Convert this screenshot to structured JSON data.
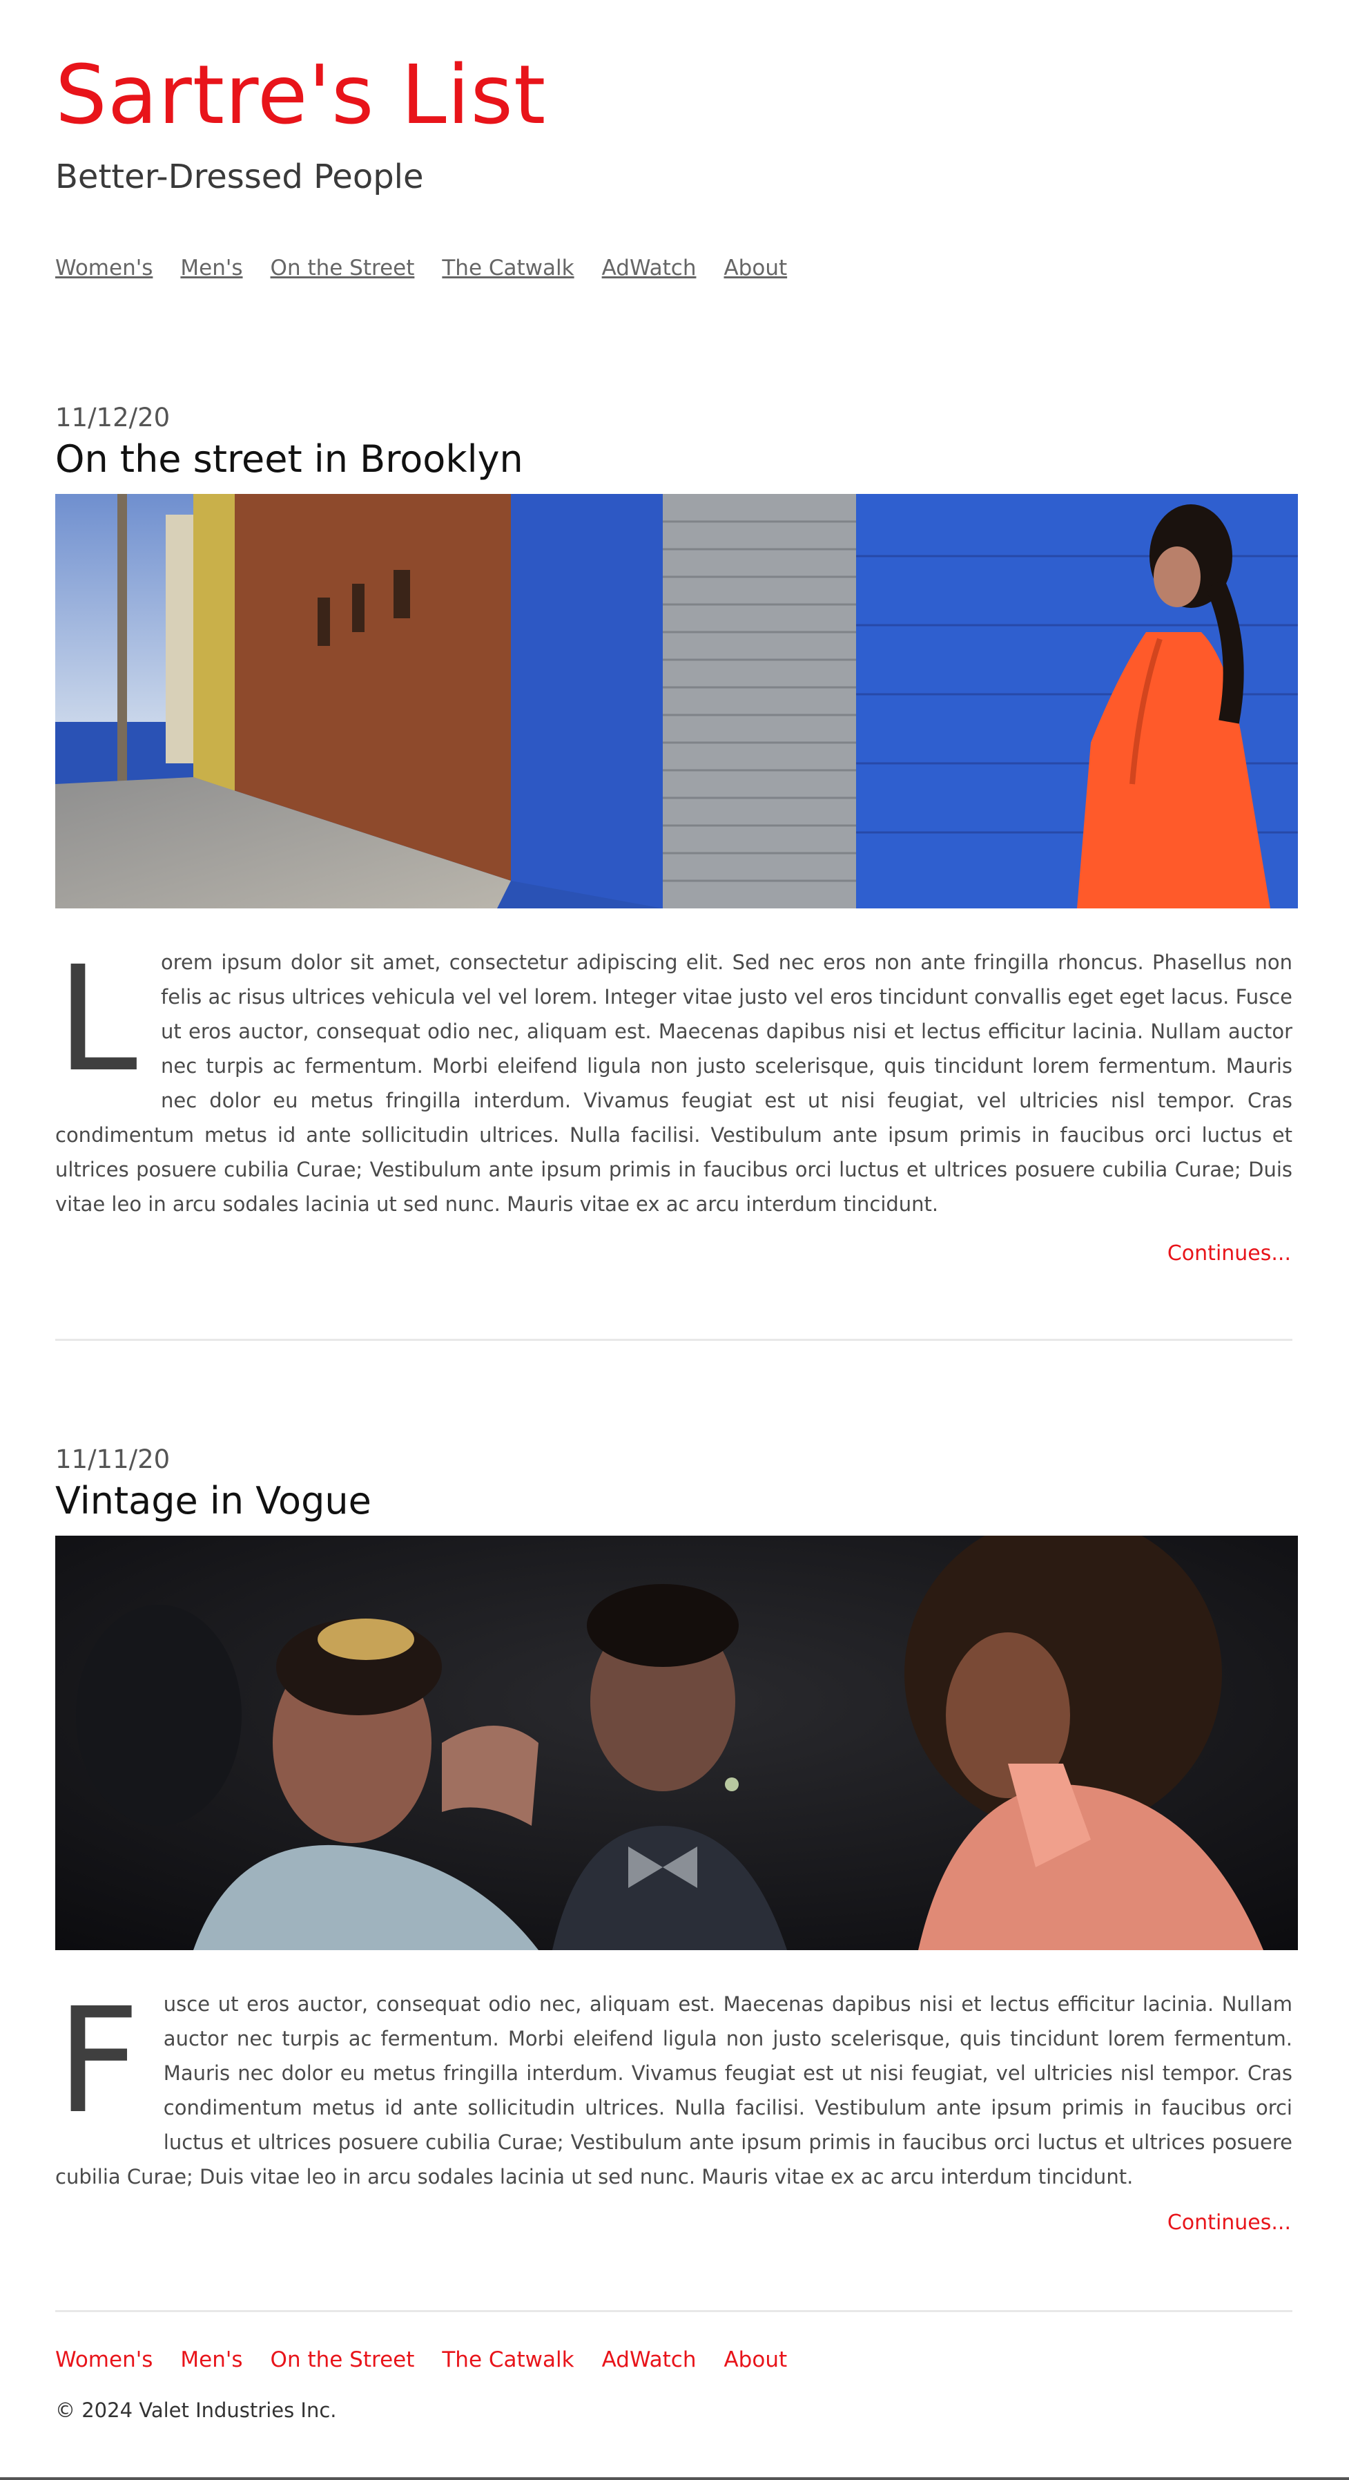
{
  "site": {
    "title": "Sartre's List",
    "tagline": "Better-Dressed People",
    "accent_color": "#e8141a"
  },
  "nav": {
    "items": [
      {
        "label": "Women's"
      },
      {
        "label": "Men's"
      },
      {
        "label": "On the Street"
      },
      {
        "label": "The Catwalk"
      },
      {
        "label": "AdWatch"
      },
      {
        "label": "About"
      }
    ]
  },
  "posts": [
    {
      "date": "11/12/20",
      "title": "On the street in Brooklyn",
      "image": "photo-woman-red-dress-blue-wall",
      "dropcap": "L",
      "body": "orem ipsum dolor sit amet, consectetur adipiscing elit. Sed nec eros non ante fringilla rhoncus. Phasellus non felis ac risus ultrices vehicula vel vel lorem. Integer vitae justo vel eros tincidunt convallis eget eget lacus. Fusce ut eros auctor, consequat odio nec, aliquam est. Maecenas dapibus nisi et lectus efficitur lacinia. Nullam auctor nec turpis ac fermentum. Morbi eleifend ligula non justo scelerisque, quis tincidunt lorem fermentum. Mauris nec dolor eu metus fringilla interdum. Vivamus feugiat est ut nisi feugiat, vel ultricies nisl tempor. Cras condimentum metus id ante sollicitudin ultrices. Nulla facilisi. Vestibulum ante ipsum primis in faucibus orci luctus et ultrices posuere cubilia Curae; Vestibulum ante ipsum primis in faucibus orci luctus et ultrices posuere cubilia Curae; Duis vitae leo in arcu sodales lacinia ut sed nunc. Mauris vitae ex ac arcu interdum tincidunt.",
      "continues_label": "Continues..."
    },
    {
      "date": "11/11/20",
      "title": "Vintage in Vogue",
      "image": "photo-three-people-night",
      "dropcap": "F",
      "body": "usce ut eros auctor, consequat odio nec, aliquam est. Maecenas dapibus nisi et lectus efficitur lacinia. Nullam auctor nec turpis ac fermentum. Morbi eleifend ligula non justo scelerisque, quis tincidunt lorem fermentum. Mauris nec dolor eu metus fringilla interdum. Vivamus feugiat est ut nisi feugiat, vel ultricies nisl tempor. Cras condimentum metus id ante sollicitudin ultrices. Nulla facilisi. Vestibulum ante ipsum primis in faucibus orci luctus et ultrices posuere cubilia Curae; Vestibulum ante ipsum primis in faucibus orci luctus et ultrices posuere cubilia Curae; Duis vitae leo in arcu sodales lacinia ut sed nunc. Mauris vitae ex ac arcu interdum tincidunt.",
      "continues_label": "Continues..."
    }
  ],
  "footer": {
    "nav": [
      {
        "label": "Women's"
      },
      {
        "label": "Men's"
      },
      {
        "label": "On the Street"
      },
      {
        "label": "The Catwalk"
      },
      {
        "label": "AdWatch"
      },
      {
        "label": "About"
      }
    ],
    "copyright": "© 2024 Valet Industries Inc."
  }
}
